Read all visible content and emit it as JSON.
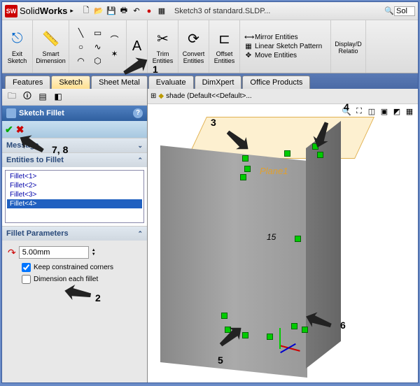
{
  "app": {
    "name_prefix": "Solid",
    "name_bold": "Works"
  },
  "document": {
    "title": "Sketch3 of standard.SLDP..."
  },
  "search": {
    "placeholder": "Sol"
  },
  "ribbon": {
    "exit_sketch": "Exit Sketch",
    "smart_dim": "Smart Dimension",
    "trim": "Trim Entities",
    "convert": "Convert Entities",
    "offset": "Offset Entities",
    "mirror": "Mirror Entities",
    "pattern": "Linear Sketch Pattern",
    "move": "Move Entities",
    "display": "Display/D Relatio"
  },
  "tabs": {
    "features": "Features",
    "sketch": "Sketch",
    "sheet_metal": "Sheet Metal",
    "evaluate": "Evaluate",
    "dimxpert": "DimXpert",
    "office": "Office Products"
  },
  "pm": {
    "title": "Sketch Fillet",
    "message_head": "Message",
    "entities_head": "Entities to Fillet",
    "fillets": [
      "Fillet<1>",
      "Fillet<2>",
      "Fillet<3>",
      "Fillet<4>"
    ],
    "params_head": "Fillet Parameters",
    "radius": "5.00mm",
    "keep_corners": "Keep constrained corners",
    "dim_each": "Dimension each fillet"
  },
  "viewport": {
    "tree_label": "shade (Default<<Default>...",
    "plane": "Plane1",
    "dim": "15"
  },
  "annotations": {
    "a1": "1",
    "a2": "2",
    "a3": "3",
    "a4": "4",
    "a5": "5",
    "a6": "6",
    "a78": "7, 8"
  }
}
